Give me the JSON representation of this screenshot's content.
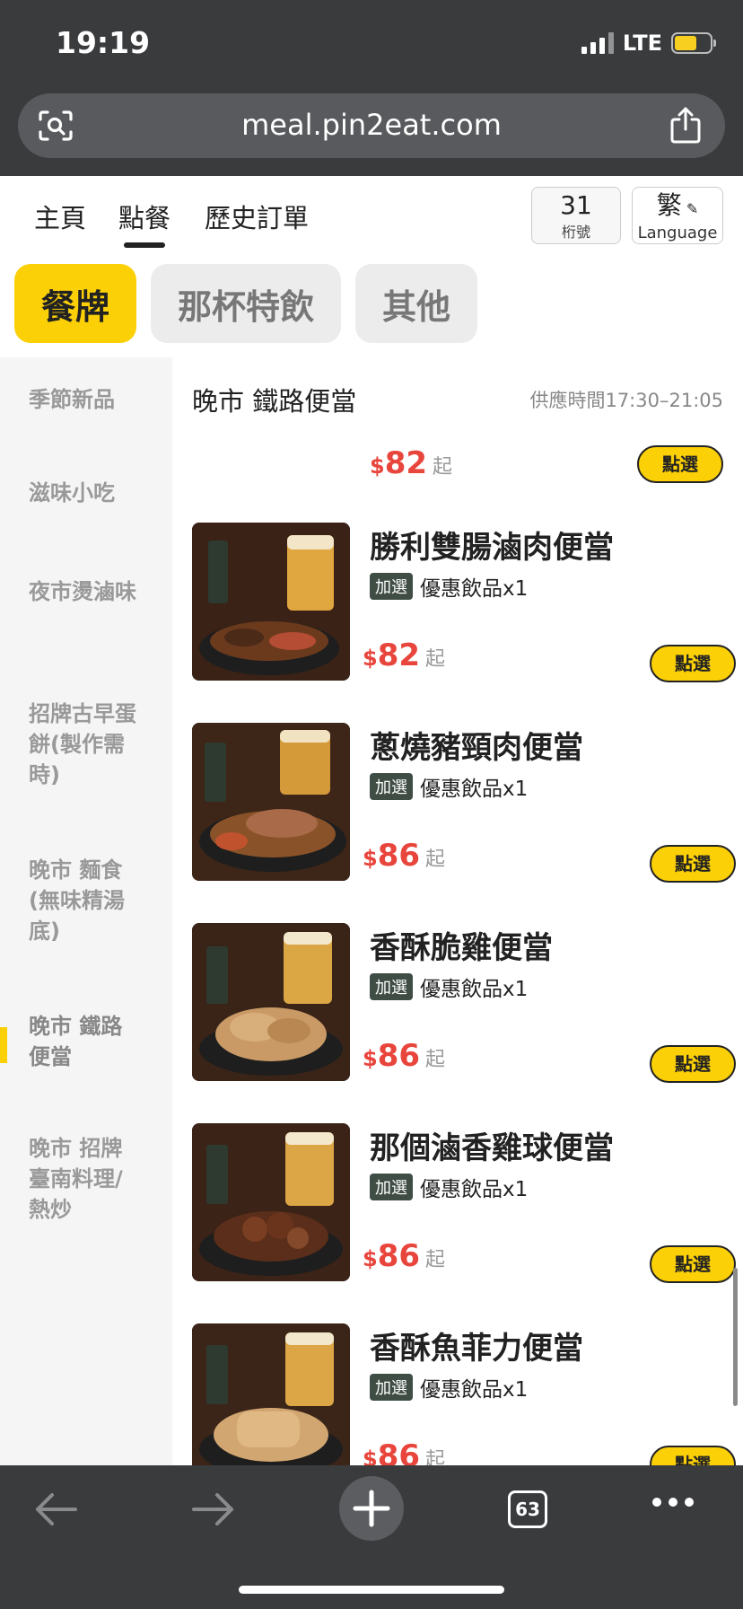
{
  "status": {
    "time": "19:19",
    "network": "LTE"
  },
  "browser": {
    "url": "meal.pin2eat.com",
    "tab_count": "63"
  },
  "header": {
    "tabs": [
      {
        "label": "主頁"
      },
      {
        "label": "點餐"
      },
      {
        "label": "歷史訂單"
      }
    ],
    "table_number": "31",
    "table_label": "桁號",
    "lang_char": "繁",
    "lang_label": "Language"
  },
  "categories": [
    {
      "label": "餐牌"
    },
    {
      "label": "那杯特飲"
    },
    {
      "label": "其他"
    }
  ],
  "sidebar": {
    "items": [
      {
        "label": "季節新品"
      },
      {
        "label": "滋味小吃"
      },
      {
        "label": "夜市燙滷味"
      },
      {
        "label": "招牌古早蛋餅(製作需時)"
      },
      {
        "label": "晚市 麵食(無味精湯底)"
      },
      {
        "label": "晚市 鐵路便當"
      },
      {
        "label": "晚市 招牌臺南料理/熱炒"
      }
    ]
  },
  "section": {
    "title": "晚市 鐵路便當",
    "serving_time": "供應時間17:30–21:05"
  },
  "common": {
    "currency": "$",
    "from_suffix": "起",
    "select_label": "點選",
    "addon_tag": "加選",
    "addon_text": "優惠飲品x1"
  },
  "partial_item": {
    "price": "82"
  },
  "items": [
    {
      "name": "勝利雙腸滷肉便當",
      "price": "82"
    },
    {
      "name": "蔥燒豬頸肉便當",
      "price": "86"
    },
    {
      "name": "香酥脆雞便當",
      "price": "86"
    },
    {
      "name": "那個滷香雞球便當",
      "price": "86"
    },
    {
      "name": "香酥魚菲力便當",
      "price": "86"
    }
  ],
  "colors": {
    "accent": "#fbd007",
    "price": "#e8453c",
    "chrome": "#3a3b3d"
  }
}
